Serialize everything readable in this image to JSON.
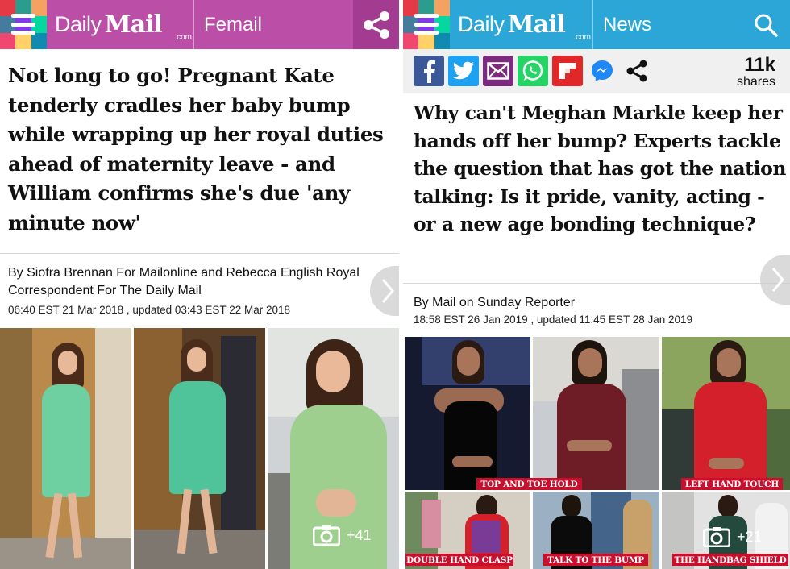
{
  "left": {
    "brand": {
      "daily": "Daily",
      "mail": "Mail",
      "com": ".com"
    },
    "section": "Femail",
    "headline": "Not long to go! Pregnant Kate tenderly cradles her baby bump while wrapping up her royal duties ahead of maternity leave - and William confirms she's due 'any minute now'",
    "byline": "By Siofra Brennan For Mailonline and Rebecca English Royal Correspondent For The Daily Mail",
    "dateline": "06:40 EST 21 Mar 2018 , updated 03:43 EST 22 Mar 2018",
    "gallery_count": "+41",
    "colors": {
      "header": "#bb4fa7",
      "share_tile": "#a33c91"
    }
  },
  "right": {
    "brand": {
      "daily": "Daily",
      "mail": "Mail",
      "com": ".com"
    },
    "section": "News",
    "share_icons": [
      "facebook-icon",
      "twitter-icon",
      "email-icon",
      "whatsapp-icon",
      "flipboard-icon",
      "messenger-icon",
      "share-icon"
    ],
    "share_count": "11k",
    "share_label": "shares",
    "headline": "Why can't Meghan Markle keep her hands off her bump? Experts tackle the question that has got the nation talking: Is it pride, vanity, acting - or a new age bonding technique?",
    "byline": "By Mail on Sunday Reporter",
    "dateline": "18:58 EST 26 Jan 2019 , updated 11:45 EST 28 Jan 2019",
    "captions": [
      "TOP AND TOE HOLD",
      "LEFT HAND TOUCH",
      "DOUBLE HAND CLASP",
      "TALK TO THE BUMP",
      "THE HANDBAG SHIELD"
    ],
    "gallery_count": "+21",
    "colors": {
      "header": "#2ba6d7",
      "caption": "#c8102e"
    }
  }
}
